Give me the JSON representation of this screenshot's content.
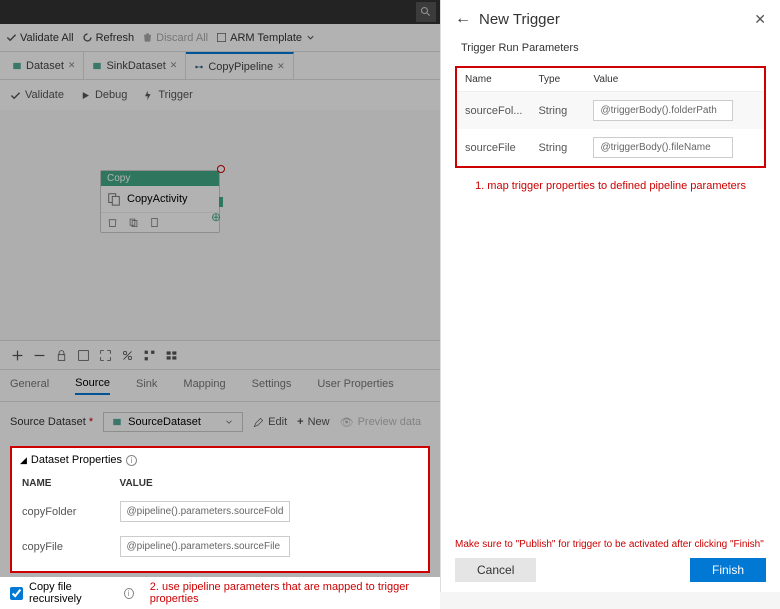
{
  "toolbar": {
    "validate_all": "Validate All",
    "refresh": "Refresh",
    "discard_all": "Discard All",
    "arm_template": "ARM Template"
  },
  "tabs": [
    {
      "label": "Dataset"
    },
    {
      "label": "SinkDataset"
    },
    {
      "label": "CopyPipeline"
    }
  ],
  "pipe_actions": {
    "validate": "Validate",
    "debug": "Debug",
    "trigger": "Trigger"
  },
  "activity": {
    "header": "Copy",
    "name": "CopyActivity"
  },
  "prop_tabs": [
    "General",
    "Source",
    "Sink",
    "Mapping",
    "Settings",
    "User Properties"
  ],
  "source": {
    "label": "Source Dataset",
    "selected": "SourceDataset",
    "edit": "Edit",
    "new": "New",
    "preview": "Preview data"
  },
  "dataset_props": {
    "title": "Dataset Properties",
    "col_name": "NAME",
    "col_value": "VALUE",
    "rows": [
      {
        "name": "copyFolder",
        "value": "@pipeline().parameters.sourceFolder"
      },
      {
        "name": "copyFile",
        "value": "@pipeline().parameters.sourceFile"
      }
    ]
  },
  "copy_recursive": "Copy file recursively",
  "annotation2": "2. use pipeline parameters that are mapped to trigger properties",
  "panel": {
    "title": "New Trigger",
    "subtitle": "Trigger Run Parameters",
    "col_name": "Name",
    "col_type": "Type",
    "col_value": "Value",
    "rows": [
      {
        "name": "sourceFol...",
        "type": "String",
        "value": "@triggerBody().folderPath"
      },
      {
        "name": "sourceFile",
        "type": "String",
        "value": "@triggerBody().fileName"
      }
    ],
    "annotation1": "1. map trigger properties to defined pipeline parameters",
    "publish_note": "Make sure to \"Publish\" for trigger to be activated after clicking \"Finish\"",
    "cancel": "Cancel",
    "finish": "Finish"
  }
}
